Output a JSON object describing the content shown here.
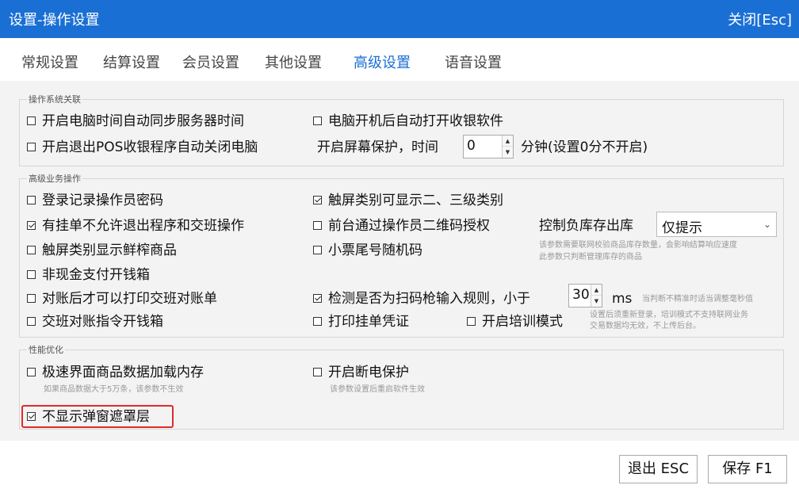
{
  "window": {
    "title": "设置-操作设置",
    "close_label": "关闭[Esc]"
  },
  "tabs": [
    {
      "label": "常规设置"
    },
    {
      "label": "结算设置"
    },
    {
      "label": "会员设置"
    },
    {
      "label": "其他设置"
    },
    {
      "label": "高级设置",
      "active": true
    },
    {
      "label": "语音设置"
    }
  ],
  "group_os": {
    "title": "操作系统关联",
    "sync_time": {
      "label": "开启电脑时间自动同步服务器时间",
      "checked": false
    },
    "auto_start": {
      "label": "电脑开机后自动打开收银软件",
      "checked": false
    },
    "auto_shutdown": {
      "label": "开启退出POS收银程序自动关闭电脑",
      "checked": false
    },
    "screensaver_label": "开启屏幕保护，时间",
    "screensaver_value": "0",
    "screensaver_suffix": "分钟(设置0分不开启)"
  },
  "group_adv": {
    "title": "高级业务操作",
    "login_pwd": {
      "label": "登录记录操作员密码",
      "checked": false
    },
    "touch_category": {
      "label": "触屏类别可显示二、三级类别",
      "checked": true
    },
    "hang_order": {
      "label": "有挂单不允许退出程序和交班操作",
      "checked": true
    },
    "qr_auth": {
      "label": "前台通过操作员二维码授权",
      "checked": false
    },
    "stock_label": "控制负库存出库",
    "stock_value": "仅提示",
    "stock_note_1": "该参数需要联网校验商品库存数量，会影响结算响应速度",
    "stock_note_2": "此参数只判断管理库存的商品",
    "fresh_goods": {
      "label": "触屏类别显示鲜榨商品",
      "checked": false
    },
    "receipt_random": {
      "label": "小票尾号随机码",
      "checked": false
    },
    "noncash_drawer": {
      "label": "非现金支付开钱箱",
      "checked": false
    },
    "print_after_check": {
      "label": "对账后才可以打印交班对账单",
      "checked": false
    },
    "scanner_detect": {
      "label": "检测是否为扫码枪输入规则，小于",
      "checked": true
    },
    "scanner_value": "30",
    "scanner_unit": "ms",
    "scanner_note": "当判断不精准时适当调整毫秒值",
    "shift_drawer": {
      "label": "交班对账指令开钱箱",
      "checked": false
    },
    "print_hang": {
      "label": "打印挂单凭证",
      "checked": false
    },
    "training_mode": {
      "label": "开启培训模式",
      "checked": false
    },
    "training_note_1": "设置后须重新登录，培训模式不支持联网业务",
    "training_note_2": "交易数据均无效，不上传后台。"
  },
  "group_perf": {
    "title": "性能优化",
    "speed_cache": {
      "label": "极速界面商品数据加载内存",
      "checked": false
    },
    "speed_note": "如果商品数据大于5万条，该参数不生效",
    "power_protect": {
      "label": "开启断电保护",
      "checked": false
    },
    "power_note": "该参数设置后重启软件生效",
    "no_mask": {
      "label": "不显示弹窗遮罩层",
      "checked": true
    }
  },
  "footer": {
    "exit_label": "退出 ESC",
    "save_label": "保存 F1"
  },
  "colors": {
    "titlebar": "#1a6fd4",
    "active_tab": "#1a6fd4",
    "highlight": "#e02a2a"
  }
}
